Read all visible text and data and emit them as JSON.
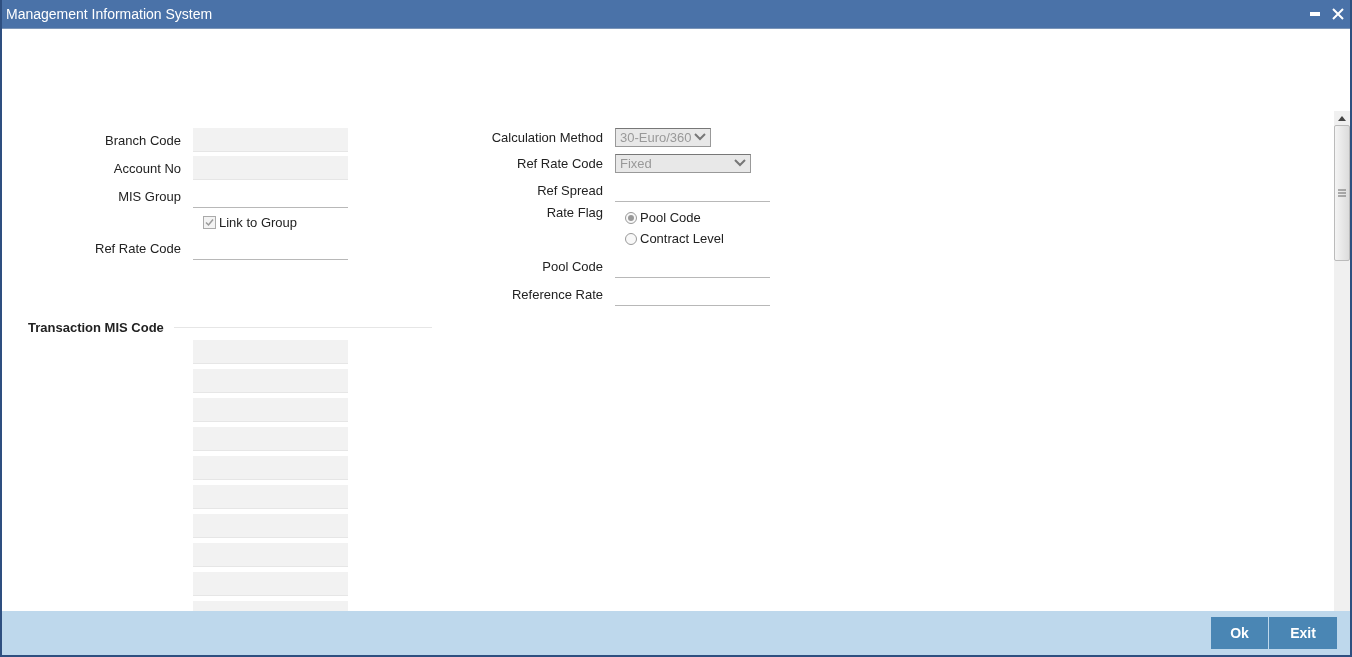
{
  "window": {
    "title": "Management Information System"
  },
  "left_fields": [
    {
      "kind": "text",
      "label": "Branch Code",
      "disabled": true
    },
    {
      "kind": "text",
      "label": "Account No",
      "disabled": true
    },
    {
      "kind": "text",
      "label": "MIS Group",
      "disabled": false
    },
    {
      "kind": "checkbox",
      "label": "Link to Group",
      "checked": true,
      "disabled": true
    },
    {
      "kind": "text",
      "label": "Ref Rate Code",
      "disabled": false
    }
  ],
  "right_fields": [
    {
      "kind": "select",
      "label": "Calculation Method",
      "value": "30-Euro/360",
      "disabled": true,
      "wide": false
    },
    {
      "kind": "select",
      "label": "Ref Rate Code",
      "value": "Fixed",
      "disabled": true,
      "wide": true
    },
    {
      "kind": "text",
      "label": "Ref Spread",
      "disabled": false
    },
    {
      "kind": "radio",
      "label": "Rate Flag",
      "options": [
        {
          "label": "Pool Code",
          "selected": true
        },
        {
          "label": "Contract Level",
          "selected": false
        }
      ]
    },
    {
      "kind": "text",
      "label": "Pool Code",
      "disabled": false
    },
    {
      "kind": "text",
      "label": "Reference Rate",
      "disabled": false
    }
  ],
  "transaction_mis_code": {
    "title": "Transaction MIS Code",
    "fields": [
      {
        "disabled": true
      },
      {
        "disabled": true
      },
      {
        "disabled": true
      },
      {
        "disabled": true
      },
      {
        "disabled": true
      },
      {
        "disabled": true
      },
      {
        "disabled": true
      },
      {
        "disabled": true
      },
      {
        "disabled": true
      },
      {
        "disabled": true
      }
    ]
  },
  "buttons": [
    "Ok",
    "Exit"
  ]
}
